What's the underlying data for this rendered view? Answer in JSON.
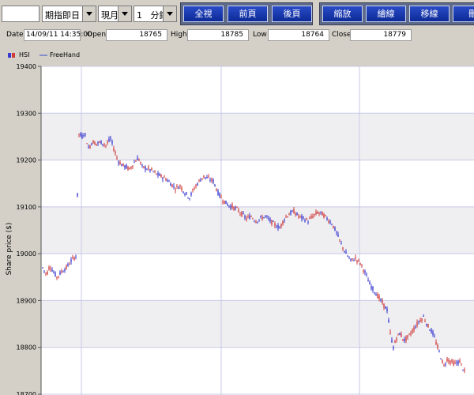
{
  "toolbar": {
    "blank_combo": "",
    "date_combo": "期指即日",
    "month_combo": "現月",
    "interval_value": "1",
    "interval_unit": "分鐘",
    "buttons_left": [
      "全視",
      "前頁",
      "後頁"
    ],
    "buttons_right": [
      "縮放",
      "繪線",
      "移線",
      "刪"
    ]
  },
  "info": {
    "date_label": "Date",
    "date_value": "14/09/11 14:35:00",
    "open_label": "Open",
    "open_value": "18765",
    "high_label": "High",
    "high_value": "18785",
    "low_label": "Low",
    "low_value": "18764",
    "close_label": "Close",
    "close_value": "18779"
  },
  "legend": {
    "series_label": "HSI",
    "freehand_label": "FreeHand"
  },
  "chart_data": {
    "type": "candlestick",
    "ylabel": "Share price ($)",
    "ylim": [
      18700,
      19400
    ],
    "yticks": [
      "19400",
      "19300",
      "19200",
      "19100",
      "19000",
      "18900",
      "18800",
      "18700"
    ],
    "grid": true,
    "band_color": "#efeff2",
    "up_color": "#3a3ad0",
    "down_color": "#d03a3a",
    "price_path": [
      [
        0,
        18970
      ],
      [
        5,
        18955
      ],
      [
        9,
        18975
      ],
      [
        14,
        18960
      ],
      [
        18,
        18950
      ],
      [
        24,
        18962
      ],
      [
        30,
        18970
      ],
      [
        36,
        18985
      ],
      [
        42,
        18995
      ],
      [
        46,
        19255
      ],
      [
        50,
        19250
      ],
      [
        53,
        19260
      ],
      [
        58,
        19225
      ],
      [
        63,
        19240
      ],
      [
        68,
        19235
      ],
      [
        74,
        19238
      ],
      [
        80,
        19232
      ],
      [
        86,
        19245
      ],
      [
        90,
        19225
      ],
      [
        95,
        19200
      ],
      [
        100,
        19190
      ],
      [
        106,
        19185
      ],
      [
        110,
        19180
      ],
      [
        116,
        19195
      ],
      [
        121,
        19205
      ],
      [
        126,
        19185
      ],
      [
        132,
        19182
      ],
      [
        138,
        19178
      ],
      [
        144,
        19170
      ],
      [
        150,
        19165
      ],
      [
        156,
        19160
      ],
      [
        162,
        19150
      ],
      [
        168,
        19140
      ],
      [
        174,
        19145
      ],
      [
        180,
        19130
      ],
      [
        186,
        19120
      ],
      [
        192,
        19140
      ],
      [
        198,
        19155
      ],
      [
        204,
        19165
      ],
      [
        210,
        19160
      ],
      [
        216,
        19155
      ],
      [
        222,
        19130
      ],
      [
        228,
        19115
      ],
      [
        234,
        19105
      ],
      [
        240,
        19100
      ],
      [
        246,
        19095
      ],
      [
        252,
        19085
      ],
      [
        258,
        19075
      ],
      [
        264,
        19080
      ],
      [
        270,
        19070
      ],
      [
        276,
        19075
      ],
      [
        282,
        19080
      ],
      [
        288,
        19070
      ],
      [
        294,
        19062
      ],
      [
        300,
        19055
      ],
      [
        306,
        19075
      ],
      [
        312,
        19085
      ],
      [
        318,
        19090
      ],
      [
        324,
        19080
      ],
      [
        330,
        19075
      ],
      [
        336,
        19070
      ],
      [
        342,
        19080
      ],
      [
        348,
        19088
      ],
      [
        354,
        19085
      ],
      [
        360,
        19075
      ],
      [
        366,
        19065
      ],
      [
        372,
        19045
      ],
      [
        378,
        19020
      ],
      [
        384,
        19000
      ],
      [
        390,
        18985
      ],
      [
        396,
        18990
      ],
      [
        402,
        18980
      ],
      [
        408,
        18960
      ],
      [
        414,
        18935
      ],
      [
        420,
        18920
      ],
      [
        426,
        18905
      ],
      [
        432,
        18890
      ],
      [
        436,
        18880
      ],
      [
        440,
        18830
      ],
      [
        444,
        18800
      ],
      [
        448,
        18820
      ],
      [
        452,
        18830
      ],
      [
        458,
        18815
      ],
      [
        464,
        18825
      ],
      [
        470,
        18840
      ],
      [
        476,
        18855
      ],
      [
        482,
        18865
      ],
      [
        488,
        18845
      ],
      [
        494,
        18830
      ],
      [
        500,
        18800
      ],
      [
        504,
        18780
      ],
      [
        508,
        18760
      ],
      [
        512,
        18775
      ],
      [
        516,
        18770
      ],
      [
        522,
        18765
      ],
      [
        528,
        18770
      ],
      [
        532,
        18755
      ],
      [
        535,
        18745
      ]
    ]
  }
}
